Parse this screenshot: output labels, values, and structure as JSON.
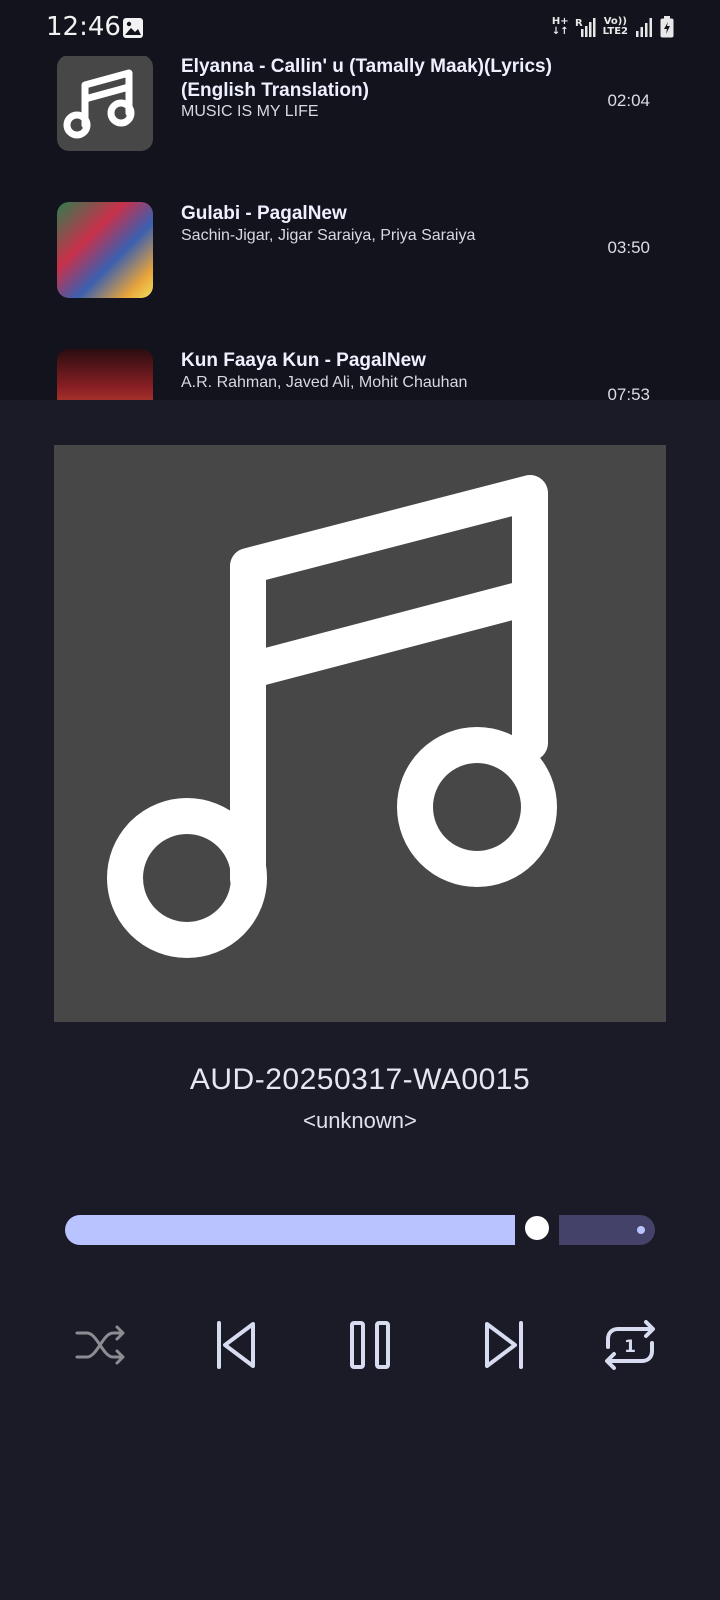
{
  "status_bar": {
    "time": "12:46",
    "network_labels": [
      "H+",
      "R",
      "Vo))",
      "LTE2"
    ]
  },
  "playlist": [
    {
      "title": "Elyanna - Callin' u (Tamally Maak)(Lyrics)(English Translation)",
      "artist": "MUSIC IS MY LIFE",
      "duration": "02:04",
      "thumb": "music-note-icon"
    },
    {
      "title": "Gulabi - PagalNew",
      "artist": "Sachin-Jigar, Jigar Saraiya, Priya Saraiya",
      "duration": "03:50",
      "thumb": "album-cover"
    },
    {
      "title": "Kun Faaya Kun - PagalNew",
      "artist": "A.R. Rahman, Javed Ali, Mohit Chauhan",
      "duration": "07:53",
      "thumb": "album-cover"
    }
  ],
  "now_playing": {
    "title": "AUD-20250317-WA0015",
    "artist": "<unknown>",
    "progress_fraction": 0.8,
    "art_icon": "music-note-icon"
  },
  "controls": {
    "shuffle": "shuffle-icon",
    "previous": "skip-previous-icon",
    "play_pause": "pause-icon",
    "next": "skip-next-icon",
    "repeat": "repeat-one-icon",
    "repeat_badge": "1"
  },
  "colors": {
    "background": "#1a1b26",
    "accent": "#b9c3ff",
    "seek_remaining": "#45426a",
    "art_placeholder": "#474747"
  }
}
